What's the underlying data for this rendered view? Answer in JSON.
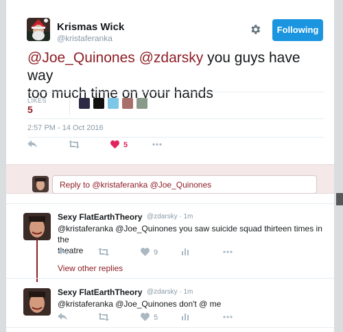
{
  "tweet": {
    "author_name": "Krismas Wick",
    "author_handle": "@kristaferanka",
    "follow_label": "Following",
    "text_mention_1": "@Joe_Quinones",
    "text_mention_2": "@zdarsky",
    "text_rest_1": " you guys have way",
    "text_rest_2": "too much time on your hands",
    "likes_label": "LIKES",
    "likes_count": "5",
    "timestamp": "2:57 PM - 14 Oct 2016",
    "like_action_count": "5",
    "liker_avatar_colors": [
      "#2c2a45",
      "#111111",
      "#7cc6e8",
      "#a8706a",
      "#8a9a8a"
    ]
  },
  "reply_box": {
    "placeholder_prefix": "Reply to ",
    "placeholder_mentions": "@kristaferanka @Joe_Quinones"
  },
  "replies": [
    {
      "name": "Sexy FlatEarthTheory",
      "handle": "@zdarsky",
      "time": "1m",
      "line1": "@kristaferanka @Joe_Quinones you saw suicide squad thirteen times in the",
      "line2": "theatre",
      "like_count": "9"
    },
    {
      "name": "Sexy FlatEarthTheory",
      "handle": "@zdarsky",
      "time": "1m",
      "line1": "@kristaferanka @Joe_Quinones don't @ me",
      "like_count": "5"
    }
  ],
  "view_other_replies": "View other replies",
  "colors": {
    "accent": "#8e1e26",
    "follow_button": "#1b95e0",
    "like_red": "#e0245e",
    "muted": "#aab8c2"
  },
  "icons": [
    "gear-icon",
    "reply-icon",
    "retweet-icon",
    "heart-icon",
    "more-icon",
    "analytics-icon"
  ]
}
